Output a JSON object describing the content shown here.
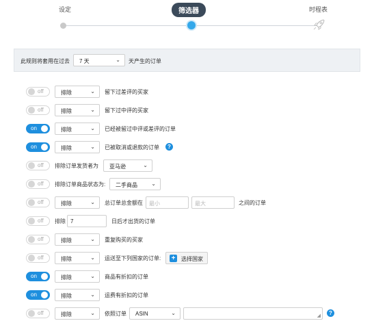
{
  "stepper": {
    "steps": [
      {
        "label": "设定"
      },
      {
        "label": "筛选器"
      },
      {
        "label": "时程表"
      }
    ]
  },
  "time_bar": {
    "prefix": "此规则将套用在过去",
    "select_value": "7 天",
    "suffix": "天产生的订单"
  },
  "toggle": {
    "on": "on",
    "off": "off"
  },
  "rules": [
    {
      "state": "off",
      "select": "排除",
      "text": "留下过差评的买家"
    },
    {
      "state": "off",
      "select": "排除",
      "text": "留下过中评的买家"
    },
    {
      "state": "on",
      "select": "排除",
      "text": "已经被留过中评或差评的订单"
    },
    {
      "state": "on",
      "select": "排除",
      "text": "已被取消或退款的订单"
    },
    {
      "state": "off",
      "text": "排除订单发货者为",
      "select": "亚马逊"
    },
    {
      "state": "off",
      "text": "排除订单商品状态为:",
      "select": "二手商品"
    },
    {
      "state": "off",
      "select": "排除",
      "text": "总订单总金额在",
      "min_placeholder": "最小",
      "max_placeholder": "最大",
      "text2": "之间的订单"
    },
    {
      "state": "off",
      "text": "排除",
      "input_value": "7",
      "text2": "日后才出货的订单"
    },
    {
      "state": "off",
      "select": "排除",
      "text": "重复购买的买家"
    },
    {
      "state": "off",
      "select": "排除",
      "text": "运送至下列国家的订单:",
      "button": "选择国家"
    },
    {
      "state": "on",
      "select": "排除",
      "text": "商品有折扣的订单"
    },
    {
      "state": "on",
      "select": "排除",
      "text": "运费有折扣的订单"
    },
    {
      "state": "off",
      "select": "排除",
      "text": "依照订单",
      "select2": "ASIN"
    }
  ],
  "icons": {
    "help": "?",
    "chevron": "⌄",
    "plus": "+",
    "grip": "◢"
  },
  "colors": {
    "accent": "#1e8fde",
    "active_step": "#34a8ea",
    "step_pill": "#3b4a5a"
  }
}
